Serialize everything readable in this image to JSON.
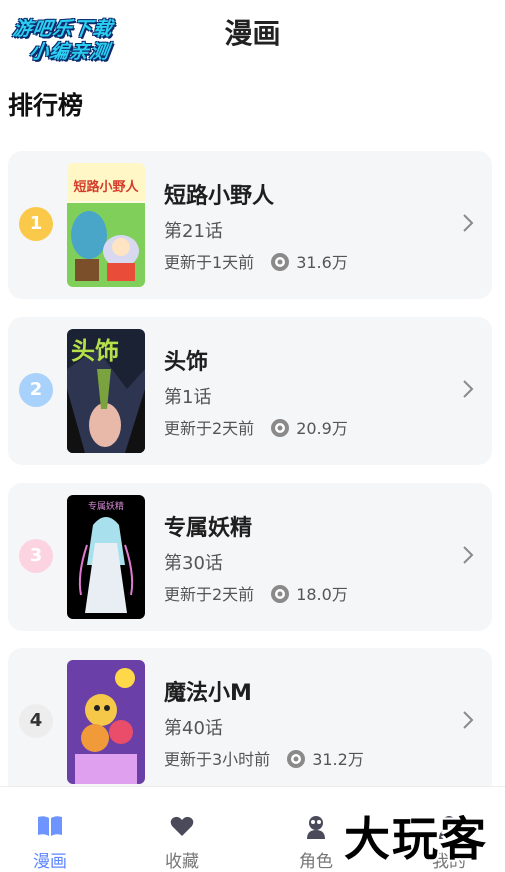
{
  "header": {
    "logo_line1": "游吧乐下载",
    "logo_line2": "小编亲测",
    "title": "漫画"
  },
  "section": {
    "title": "排行榜"
  },
  "ranking": [
    {
      "rank": "1",
      "title": "短路小野人",
      "chapter": "第21话",
      "updated": "更新于1天前",
      "views": "31.6万",
      "cover_text": "短路小野人"
    },
    {
      "rank": "2",
      "title": "头饰",
      "chapter": "第1话",
      "updated": "更新于2天前",
      "views": "20.9万",
      "cover_text": "头饰"
    },
    {
      "rank": "3",
      "title": "专属妖精",
      "chapter": "第30话",
      "updated": "更新于2天前",
      "views": "18.0万",
      "cover_text": "专属妖精"
    },
    {
      "rank": "4",
      "title": "魔法小M",
      "chapter": "第40话",
      "updated": "更新于3小时前",
      "views": "31.2万"
    }
  ],
  "rank_colors": [
    "#fbc94a",
    "#a8d1fb",
    "#fcd3e1",
    "#ededed"
  ],
  "tabs": [
    {
      "label": "漫画",
      "icon": "book-icon",
      "active": true
    },
    {
      "label": "收藏",
      "icon": "heart-icon",
      "active": false
    },
    {
      "label": "角色",
      "icon": "person-icon",
      "active": false
    },
    {
      "label": "我的",
      "icon": "user-icon",
      "active": false
    }
  ],
  "watermark": "大玩客",
  "colors": {
    "accent": "#5d86ff",
    "card_bg": "#f5f6f8"
  }
}
